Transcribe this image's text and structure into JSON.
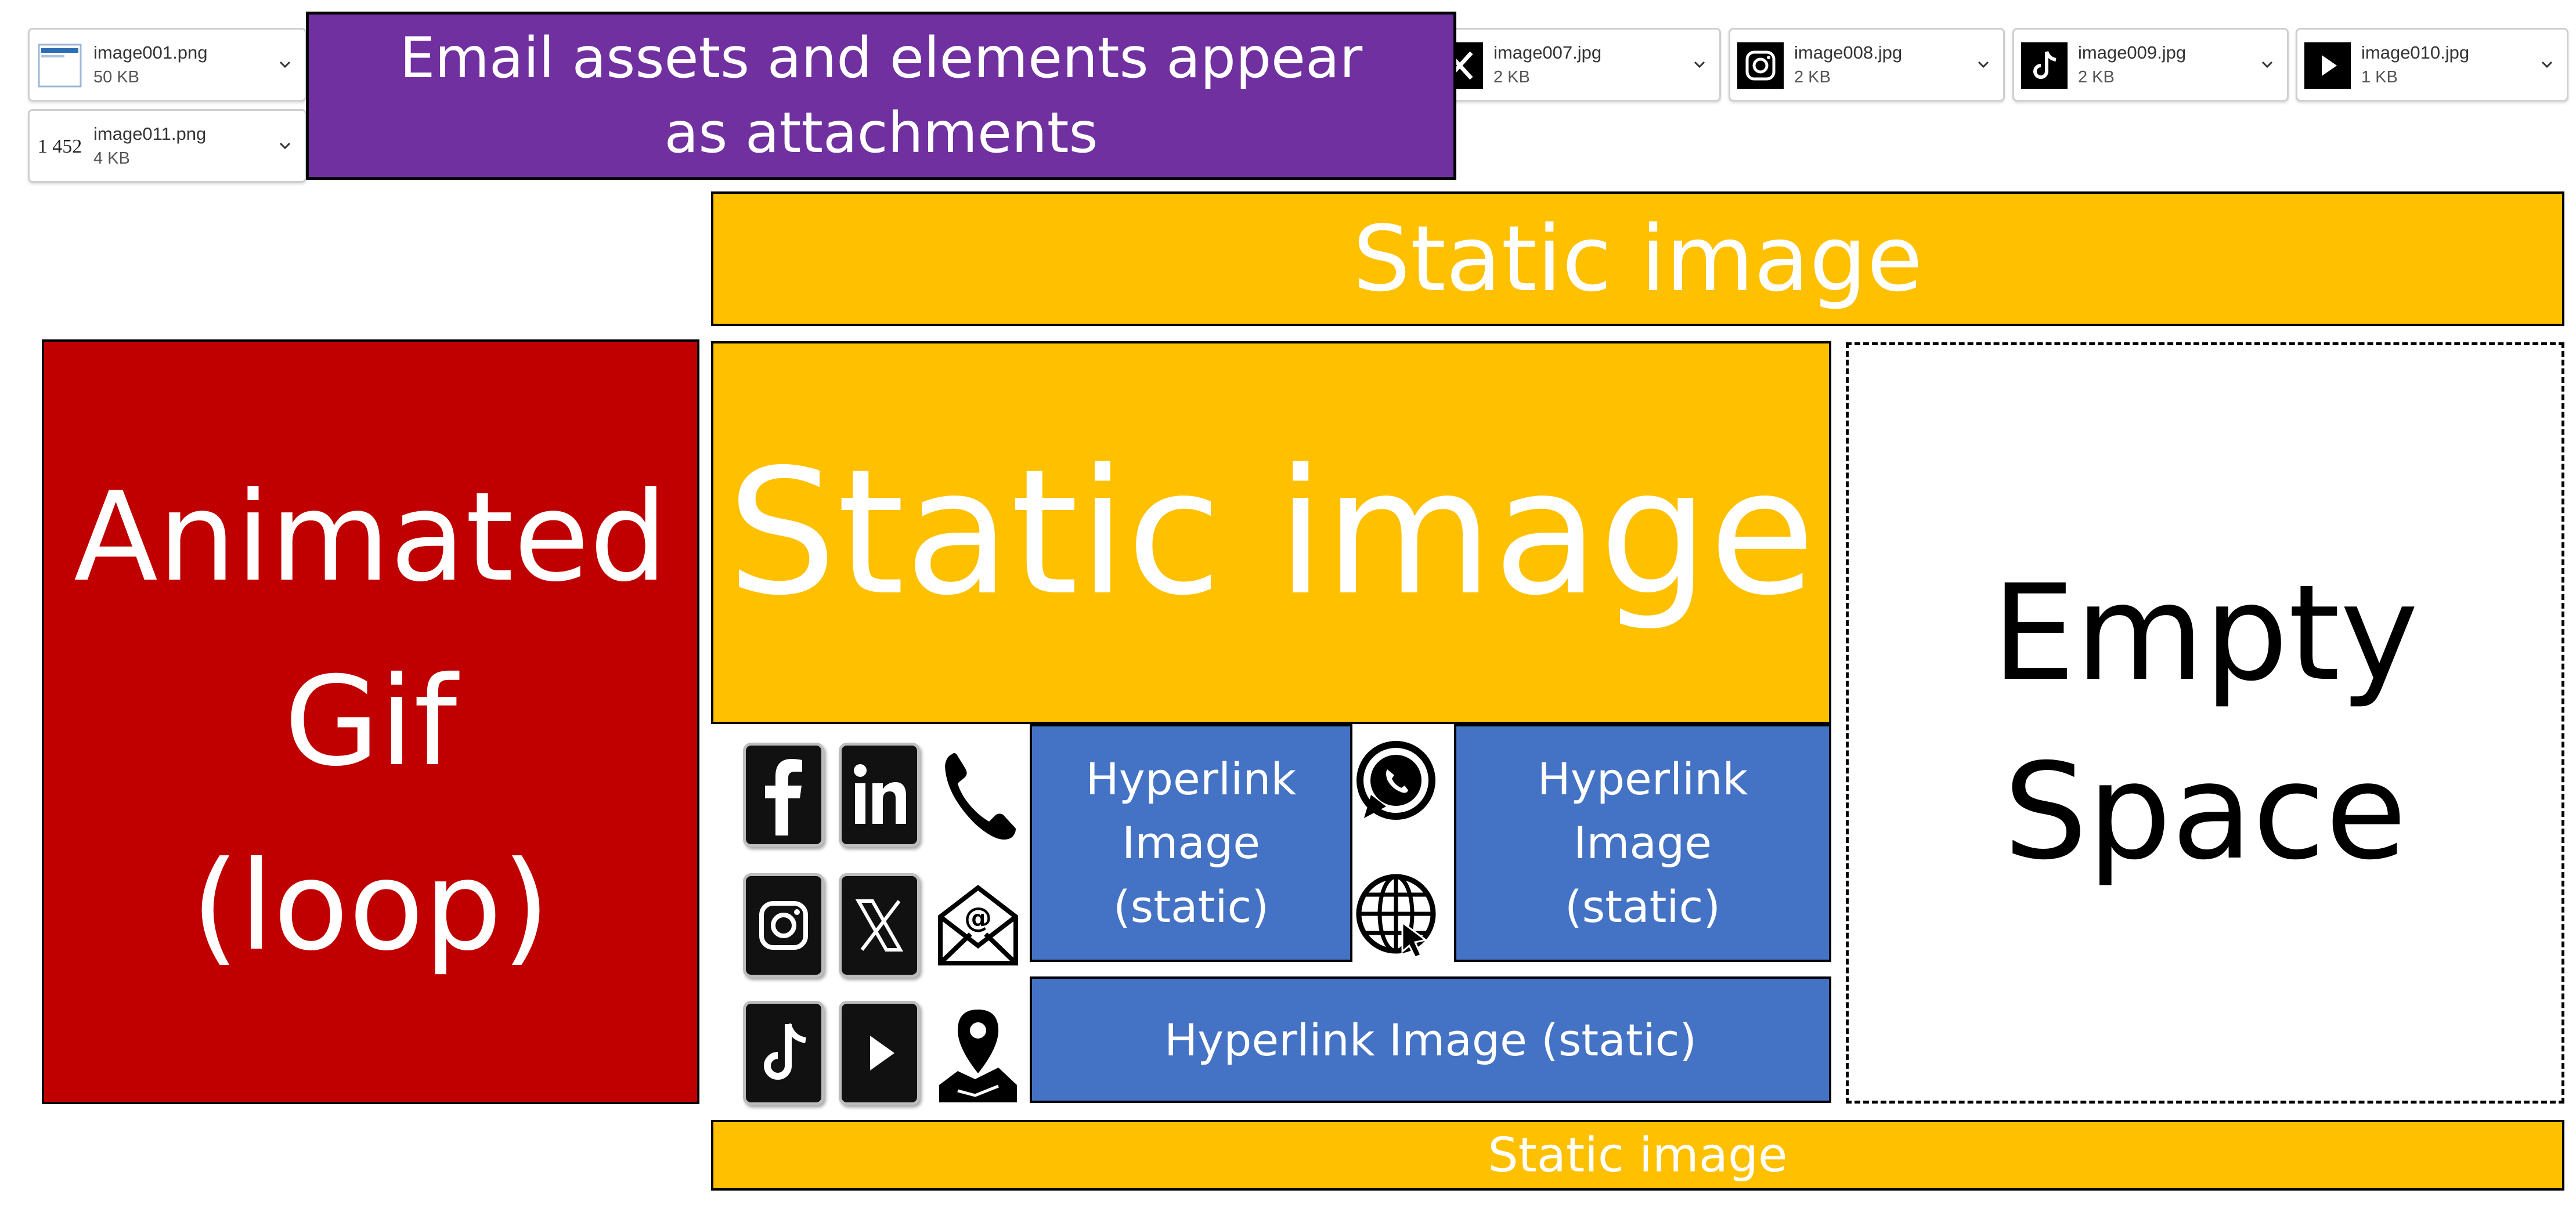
{
  "banner": {
    "title": "Email assets and elements appear as attachments"
  },
  "attachments": [
    {
      "name": "image001.png",
      "size": "50 KB",
      "icon": "image-thumb"
    },
    {
      "name": "image007.jpg",
      "size": "2 KB",
      "icon": "x-icon"
    },
    {
      "name": "image008.jpg",
      "size": "2 KB",
      "icon": "instagram-icon"
    },
    {
      "name": "image009.jpg",
      "size": "2 KB",
      "icon": "tiktok-icon"
    },
    {
      "name": "image010.jpg",
      "size": "1 KB",
      "icon": "play-icon"
    },
    {
      "name": "image011.png",
      "size": "4 KB",
      "icon": "number-thumb",
      "thumb_text": "1 452"
    }
  ],
  "blocks": {
    "top_banner": "Static image",
    "animated_gif": {
      "line1": "Animated",
      "line2": "Gif",
      "line3": "(loop)"
    },
    "main_static": "Static image",
    "empty_space": {
      "line1": "Empty",
      "line2": "Space"
    },
    "hyperlink_left": {
      "line1": "Hyperlink",
      "line2": "Image",
      "line3": "(static)"
    },
    "hyperlink_right": {
      "line1": "Hyperlink",
      "line2": "Image",
      "line3": "(static)"
    },
    "hyperlink_wide": "Hyperlink Image (static)",
    "bottom_banner": "Static image"
  },
  "social_icons": [
    "facebook-icon",
    "linkedin-icon",
    "phone-icon",
    "instagram-icon",
    "x-icon",
    "email-icon",
    "tiktok-icon",
    "play-icon",
    "location-pin-icon",
    "whatsapp-icon",
    "globe-icon"
  ],
  "colors": {
    "purple": "#7030A0",
    "gold": "#FFC000",
    "red": "#C00000",
    "blue": "#4472C4",
    "black": "#000000"
  }
}
